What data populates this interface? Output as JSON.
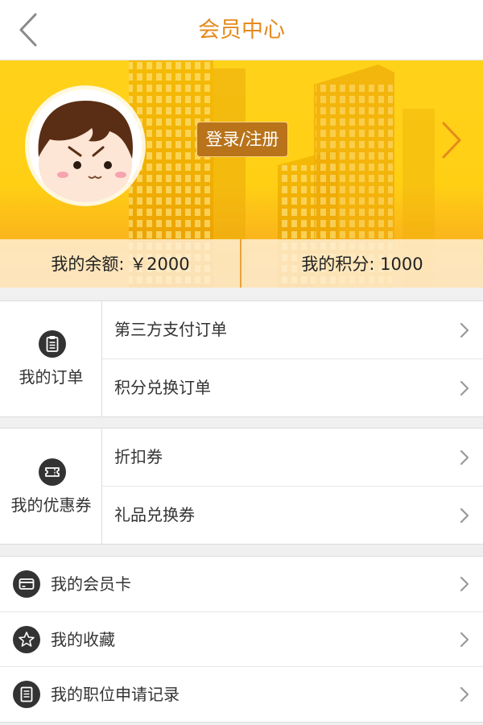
{
  "header": {
    "title": "会员中心",
    "back_icon": "chevron-left-icon"
  },
  "banner": {
    "login_label": "登录/注册",
    "next_icon": "chevron-right-icon",
    "balance_label": "我的余额: ￥2000",
    "points_label": "我的积分: 1000"
  },
  "orders": {
    "title": "我的订单",
    "icon": "clipboard-icon",
    "items": [
      {
        "label": "第三方支付订单"
      },
      {
        "label": "积分兑换订单"
      }
    ]
  },
  "coupons": {
    "title": "我的优惠券",
    "icon": "ticket-icon",
    "items": [
      {
        "label": "折扣券"
      },
      {
        "label": "礼品兑换券"
      }
    ]
  },
  "menu": [
    {
      "label": "我的会员卡",
      "icon": "card-icon"
    },
    {
      "label": "我的收藏",
      "icon": "star-icon"
    },
    {
      "label": "我的职位申请记录",
      "icon": "document-icon"
    }
  ],
  "colors": {
    "accent": "#e58a1e",
    "login_button": "#b8731b",
    "banner": "#ffcf14",
    "icon_bg": "#333333"
  }
}
